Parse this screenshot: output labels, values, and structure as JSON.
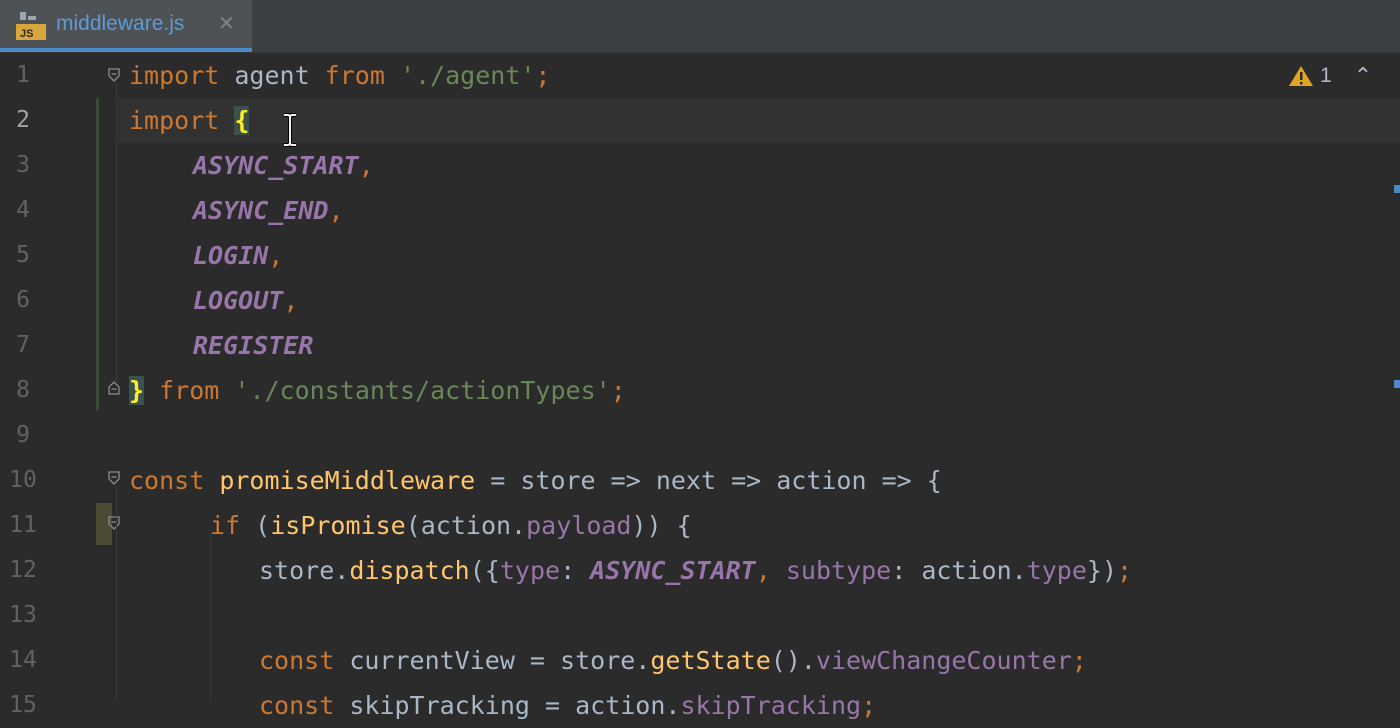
{
  "tab": {
    "title": "middleware.js",
    "icon_label": "JS",
    "close_glyph": "✕"
  },
  "inspections": {
    "warning_count": "1",
    "up_glyph": "⌃"
  },
  "line_numbers": [
    "1",
    "2",
    "3",
    "4",
    "5",
    "6",
    "7",
    "8",
    "9",
    "10",
    "11",
    "12",
    "13",
    "14",
    "15"
  ],
  "colors": {
    "keyword": "#cc7832",
    "string": "#6a8759",
    "constant": "#9876aa",
    "function": "#ffc66d",
    "text": "#a9b7c6",
    "accent": "#4a88c7"
  },
  "code": {
    "l1": {
      "kw": "import",
      "a": " agent ",
      "kw2": "from",
      "sp": " ",
      "str": "'./agent'",
      "end": ";"
    },
    "l2": {
      "kw": "import",
      "sp": " ",
      "brace": "{"
    },
    "l3": {
      "const": "ASYNC_START",
      "end": ","
    },
    "l4": {
      "const": "ASYNC_END",
      "end": ","
    },
    "l5": {
      "const": "LOGIN",
      "end": ","
    },
    "l6": {
      "const": "LOGOUT",
      "end": ","
    },
    "l7": {
      "const": "REGISTER"
    },
    "l8": {
      "brace": "}",
      "sp": " ",
      "kw": "from",
      "sp2": " ",
      "str": "'./constants/actionTypes'",
      "end": ";"
    },
    "l10": {
      "kw": "const",
      "sp": " ",
      "fn": "promiseMiddleware",
      "rest": " = store => next => action => {"
    },
    "l11": {
      "kw": "if",
      "a": " (",
      "fn": "isPromise",
      "b": "(action.",
      "prop": "payload",
      "c": ")) {"
    },
    "l12": {
      "a": "store.",
      "fn": "dispatch",
      "b": "({",
      "p1": "type",
      "c": ": ",
      "const": "ASYNC_START",
      "d": ", ",
      "p2": "subtype",
      "e": ": action.",
      "p3": "type",
      "f": "})",
      "end": ";"
    },
    "l14": {
      "kw": "const",
      "a": " currentView = store.",
      "fn": "getState",
      "b": "().",
      "prop": "viewChangeCounter",
      "end": ";"
    },
    "l15": {
      "kw": "const",
      "a": " skipTracking = action.",
      "prop": "skipTracking",
      "end": ";"
    }
  }
}
